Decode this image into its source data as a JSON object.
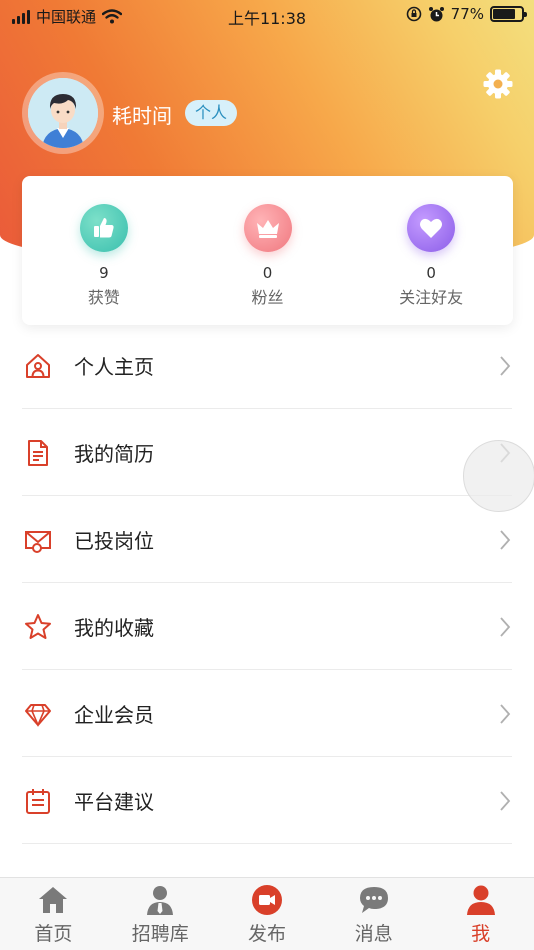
{
  "status_bar": {
    "carrier": "中国联通",
    "time": "上午11:38",
    "battery": "77%",
    "battery_level": 0.77
  },
  "profile": {
    "name": "耗时间",
    "tag": "个人"
  },
  "stats": [
    {
      "value": "9",
      "label": "获赞",
      "icon": "thumbs-up-icon",
      "color": "#3fc7b3"
    },
    {
      "value": "0",
      "label": "粉丝",
      "icon": "crown-icon",
      "color": "#f07f86"
    },
    {
      "value": "0",
      "label": "关注好友",
      "icon": "heart-icon",
      "color": "#9a6cf2"
    }
  ],
  "menu": [
    {
      "label": "个人主页",
      "icon": "home-icon"
    },
    {
      "label": "我的简历",
      "icon": "document-icon"
    },
    {
      "label": "已投岗位",
      "icon": "envelope-icon"
    },
    {
      "label": "我的收藏",
      "icon": "star-icon"
    },
    {
      "label": "企业会员",
      "icon": "diamond-icon"
    },
    {
      "label": "平台建议",
      "icon": "clipboard-icon"
    }
  ],
  "tabs": [
    {
      "label": "首页",
      "icon": "home-tab-icon"
    },
    {
      "label": "招聘库",
      "icon": "person-tie-icon"
    },
    {
      "label": "发布",
      "icon": "video-publish-icon"
    },
    {
      "label": "消息",
      "icon": "chat-bubble-icon"
    },
    {
      "label": "我",
      "icon": "user-icon"
    }
  ],
  "colors": {
    "accent": "#d9402a",
    "header_gradient_start": "#ea5a3a",
    "header_gradient_end": "#f3df7e"
  }
}
